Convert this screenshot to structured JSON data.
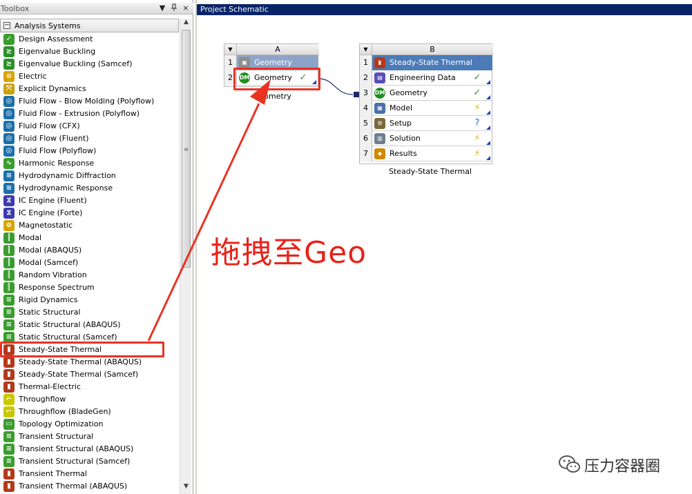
{
  "toolbox": {
    "title": "Toolbox",
    "buttons": {
      "dropdown": "▼",
      "pin": "ᵖ",
      "close": "×"
    },
    "group": {
      "toggle": "−",
      "label": "Analysis Systems"
    },
    "items": [
      {
        "label": "Design Assessment",
        "icon": "check-icon",
        "color": "#3a9c2e",
        "glyph": "✓"
      },
      {
        "label": "Eigenvalue Buckling",
        "icon": "buckling-icon",
        "color": "#2f8f2a",
        "glyph": "≳"
      },
      {
        "label": "Eigenvalue Buckling (Samcef)",
        "icon": "buckling-icon",
        "color": "#2f8f2a",
        "glyph": "≳"
      },
      {
        "label": "Electric",
        "icon": "electric-icon",
        "color": "#d9a400",
        "glyph": "⊙"
      },
      {
        "label": "Explicit Dynamics",
        "icon": "explicit-icon",
        "color": "#c9a10a",
        "glyph": "⤧"
      },
      {
        "label": "Fluid Flow - Blow Molding (Polyflow)",
        "icon": "fluid-icon",
        "color": "#1d6fa8",
        "glyph": "◎"
      },
      {
        "label": "Fluid Flow - Extrusion (Polyflow)",
        "icon": "fluid-icon",
        "color": "#1d6fa8",
        "glyph": "◎"
      },
      {
        "label": "Fluid Flow (CFX)",
        "icon": "fluid-icon",
        "color": "#1d6fa8",
        "glyph": "◎"
      },
      {
        "label": "Fluid Flow (Fluent)",
        "icon": "fluid-icon",
        "color": "#1d6fa8",
        "glyph": "◎"
      },
      {
        "label": "Fluid Flow (Polyflow)",
        "icon": "fluid-icon",
        "color": "#1d6fa8",
        "glyph": "◎"
      },
      {
        "label": "Harmonic Response",
        "icon": "wave-icon",
        "color": "#3a9c2e",
        "glyph": "∿"
      },
      {
        "label": "Hydrodynamic Diffraction",
        "icon": "hydro-icon",
        "color": "#1d6fa8",
        "glyph": "≋"
      },
      {
        "label": "Hydrodynamic Response",
        "icon": "hydro-icon",
        "color": "#1d6fa8",
        "glyph": "≋"
      },
      {
        "label": "IC Engine (Fluent)",
        "icon": "engine-icon",
        "color": "#3b3bb0",
        "glyph": "⧖"
      },
      {
        "label": "IC Engine (Forte)",
        "icon": "engine-icon",
        "color": "#3b3bb0",
        "glyph": "⧖"
      },
      {
        "label": "Magnetostatic",
        "icon": "magnet-icon",
        "color": "#d9a400",
        "glyph": "⊚"
      },
      {
        "label": "Modal",
        "icon": "modal-icon",
        "color": "#3a9c2e",
        "glyph": "┃"
      },
      {
        "label": "Modal (ABAQUS)",
        "icon": "modal-icon",
        "color": "#3a9c2e",
        "glyph": "┃"
      },
      {
        "label": "Modal (Samcef)",
        "icon": "modal-icon",
        "color": "#3a9c2e",
        "glyph": "┃"
      },
      {
        "label": "Random Vibration",
        "icon": "vibration-icon",
        "color": "#3a9c2e",
        "glyph": "║"
      },
      {
        "label": "Response Spectrum",
        "icon": "spectrum-icon",
        "color": "#3a9c2e",
        "glyph": "║"
      },
      {
        "label": "Rigid Dynamics",
        "icon": "rigid-icon",
        "color": "#3a9c2e",
        "glyph": "≡"
      },
      {
        "label": "Static Structural",
        "icon": "structural-icon",
        "color": "#3a9c2e",
        "glyph": "≡"
      },
      {
        "label": "Static Structural (ABAQUS)",
        "icon": "structural-icon",
        "color": "#3a9c2e",
        "glyph": "≡"
      },
      {
        "label": "Static Structural (Samcef)",
        "icon": "structural-icon",
        "color": "#3a9c2e",
        "glyph": "≡"
      },
      {
        "label": "Steady-State Thermal",
        "icon": "thermal-icon",
        "color": "#b23a1c",
        "glyph": "▮"
      },
      {
        "label": "Steady-State Thermal (ABAQUS)",
        "icon": "thermal-icon",
        "color": "#b23a1c",
        "glyph": "▮"
      },
      {
        "label": "Steady-State Thermal (Samcef)",
        "icon": "thermal-icon",
        "color": "#b23a1c",
        "glyph": "▮"
      },
      {
        "label": "Thermal-Electric",
        "icon": "thermal-electric-icon",
        "color": "#b23a1c",
        "glyph": "▮"
      },
      {
        "label": "Throughflow",
        "icon": "throughflow-icon",
        "color": "#c9c800",
        "glyph": "⌐"
      },
      {
        "label": "Throughflow (BladeGen)",
        "icon": "throughflow-icon",
        "color": "#c9c800",
        "glyph": "⌐"
      },
      {
        "label": "Topology Optimization",
        "icon": "topology-icon",
        "color": "#3a9c2e",
        "glyph": "▭"
      },
      {
        "label": "Transient Structural",
        "icon": "transient-icon",
        "color": "#3a9c2e",
        "glyph": "≡"
      },
      {
        "label": "Transient Structural (ABAQUS)",
        "icon": "transient-icon",
        "color": "#3a9c2e",
        "glyph": "≡"
      },
      {
        "label": "Transient Structural (Samcef)",
        "icon": "transient-icon",
        "color": "#3a9c2e",
        "glyph": "≡"
      },
      {
        "label": "Transient Thermal",
        "icon": "transient-thermal-icon",
        "color": "#b23a1c",
        "glyph": "▮"
      },
      {
        "label": "Transient Thermal (ABAQUS)",
        "icon": "transient-thermal-icon",
        "color": "#b23a1c",
        "glyph": "▮"
      }
    ],
    "scrollbar": {
      "up": "▲",
      "down": "▼",
      "grip": "≡"
    }
  },
  "schematic": {
    "title": "Project Schematic",
    "block_a": {
      "letter": "A",
      "rows": [
        {
          "num": "1",
          "label": "Geometry",
          "icon": "geometry-box-icon",
          "status": ""
        },
        {
          "num": "2",
          "label": "Geometry",
          "icon": "dm-icon",
          "status": "✓"
        }
      ],
      "caption": "Geometry"
    },
    "block_b": {
      "letter": "B",
      "rows": [
        {
          "num": "1",
          "label": "Steady-State Thermal",
          "icon": "thermal-icon",
          "status": ""
        },
        {
          "num": "2",
          "label": "Engineering Data",
          "icon": "book-icon",
          "status": "✓"
        },
        {
          "num": "3",
          "label": "Geometry",
          "icon": "dm-icon",
          "status": "✓"
        },
        {
          "num": "4",
          "label": "Model",
          "icon": "model-icon",
          "status": "⚡"
        },
        {
          "num": "5",
          "label": "Setup",
          "icon": "setup-icon",
          "status": "?"
        },
        {
          "num": "6",
          "label": "Solution",
          "icon": "solution-icon",
          "status": "⚡"
        },
        {
          "num": "7",
          "label": "Results",
          "icon": "results-icon",
          "status": "⚡"
        }
      ],
      "caption": "Steady-State Thermal"
    },
    "block_arrow": "▼"
  },
  "annotation": {
    "text": "拖拽至Geo",
    "color": "#e8231b"
  },
  "watermark": {
    "text": "压力容器圈"
  }
}
